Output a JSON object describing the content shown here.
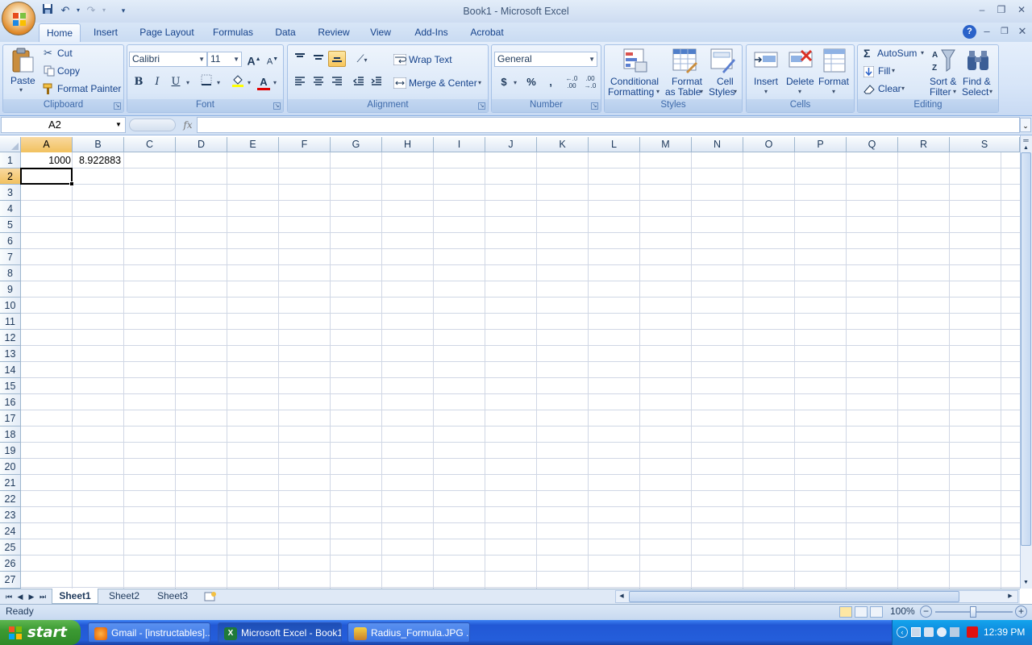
{
  "window": {
    "title": "Book1 - Microsoft Excel"
  },
  "tabs": [
    "Home",
    "Insert",
    "Page Layout",
    "Formulas",
    "Data",
    "Review",
    "View",
    "Add-Ins",
    "Acrobat"
  ],
  "ribbon": {
    "clipboard": {
      "label": "Clipboard",
      "paste": "Paste",
      "cut": "Cut",
      "copy": "Copy",
      "format_painter": "Format Painter"
    },
    "font": {
      "label": "Font",
      "name": "Calibri",
      "size": "11",
      "bold": "B",
      "italic": "I",
      "underline": "U",
      "grow": "A",
      "shrink": "A"
    },
    "alignment": {
      "label": "Alignment",
      "wrap_text": "Wrap Text",
      "merge_center": "Merge & Center"
    },
    "number": {
      "label": "Number",
      "format": "General",
      "currency": "$",
      "percent": "%",
      "comma": ",",
      "inc_decimal": "←.0 .00",
      "dec_decimal": ".00 →.0"
    },
    "styles": {
      "label": "Styles",
      "conditional_formatting_1": "Conditional",
      "conditional_formatting_2": "Formatting",
      "format_table_1": "Format",
      "format_table_2": "as Table",
      "cell_styles_1": "Cell",
      "cell_styles_2": "Styles"
    },
    "cells": {
      "label": "Cells",
      "insert": "Insert",
      "delete": "Delete",
      "format": "Format"
    },
    "editing": {
      "label": "Editing",
      "autosum": "AutoSum",
      "fill": "Fill",
      "clear": "Clear",
      "sort_1": "Sort &",
      "sort_2": "Filter",
      "find_1": "Find &",
      "find_2": "Select"
    }
  },
  "formula_bar": {
    "name_box": "A2",
    "fx": "fx",
    "content": ""
  },
  "columns": [
    "A",
    "B",
    "C",
    "D",
    "E",
    "F",
    "G",
    "H",
    "I",
    "J",
    "K",
    "L",
    "M",
    "N",
    "O",
    "P",
    "Q",
    "R",
    "S"
  ],
  "rows": [
    "1",
    "2",
    "3",
    "4",
    "5",
    "6",
    "7",
    "8",
    "9",
    "10",
    "11",
    "12",
    "13",
    "14",
    "15",
    "16",
    "17",
    "18",
    "19",
    "20",
    "21",
    "22",
    "23",
    "24",
    "25",
    "26",
    "27"
  ],
  "cells": {
    "A1": "1000",
    "B1": "8.922883"
  },
  "sheets": [
    "Sheet1",
    "Sheet2",
    "Sheet3"
  ],
  "status": {
    "text": "Ready",
    "zoom": "100%"
  },
  "taskbar": {
    "start": "start",
    "items": [
      "Gmail - [instructables]...",
      "Microsoft Excel - Book1",
      "Radius_Formula.JPG ..."
    ],
    "clock": "12:39 PM"
  },
  "colors": {
    "ribbon": "#dbe8f8",
    "accent": "#15428b",
    "active_header": "#f1c15f",
    "taskbar": "#245edb",
    "start": "#3c9a33"
  }
}
